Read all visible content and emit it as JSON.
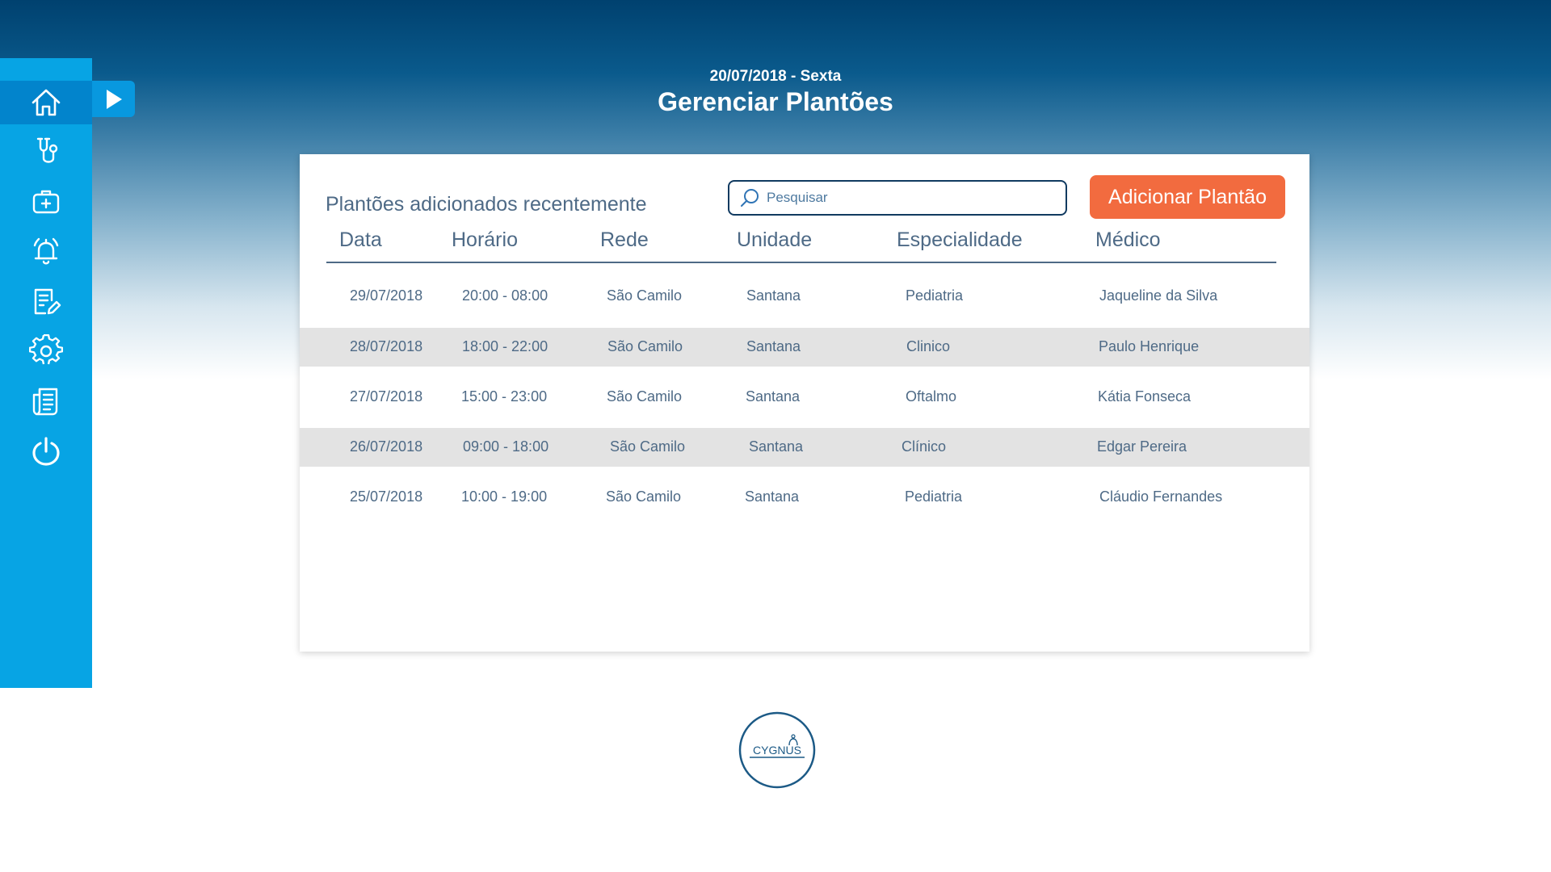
{
  "header": {
    "date": "20/07/2018 - Sexta",
    "title": "Gerenciar Plantões"
  },
  "sidebar": {
    "items": [
      {
        "icon": "home-icon"
      },
      {
        "icon": "stethoscope-icon"
      },
      {
        "icon": "medical-kit-icon"
      },
      {
        "icon": "alarm-icon"
      },
      {
        "icon": "edit-document-icon"
      },
      {
        "icon": "gear-icon"
      },
      {
        "icon": "documents-icon"
      },
      {
        "icon": "power-icon"
      }
    ],
    "expand_icon": "play-arrow-icon"
  },
  "main": {
    "heading": "Plantões adicionados recentemente",
    "search": {
      "placeholder": "Pesquisar",
      "value": ""
    },
    "add_button_label": "Adicionar Plantão",
    "table": {
      "columns": [
        "Data",
        "Horário",
        "Rede",
        "Unidade",
        "Especialidade",
        "Médico"
      ],
      "rows": [
        [
          "29/07/2018",
          "20:00 - 08:00",
          "São Camilo",
          "Santana",
          "Pediatria",
          "Jaqueline da Silva"
        ],
        [
          "28/07/2018",
          "18:00 - 22:00",
          "São Camilo",
          "Santana",
          "Clinico",
          "Paulo Henrique"
        ],
        [
          "27/07/2018",
          "15:00 - 23:00",
          "São Camilo",
          "Santana",
          "Oftalmo",
          "Kátia Fonseca"
        ],
        [
          "26/07/2018",
          "09:00 - 18:00",
          "São Camilo",
          "Santana",
          "Clínico",
          "Edgar Pereira"
        ],
        [
          "25/07/2018",
          "10:00 - 19:00",
          "São Camilo",
          "Santana",
          "Pediatria",
          "Cláudio Fernandes"
        ]
      ]
    }
  },
  "logo": {
    "text": "CYGNUS"
  },
  "colors": {
    "sidebar": "#07a4e4",
    "sidebar_active": "#0284cc",
    "accent": "#f26b3f",
    "text": "#4e6a86",
    "header_dark": "#00416f",
    "row_shade": "#e3e3e3"
  }
}
